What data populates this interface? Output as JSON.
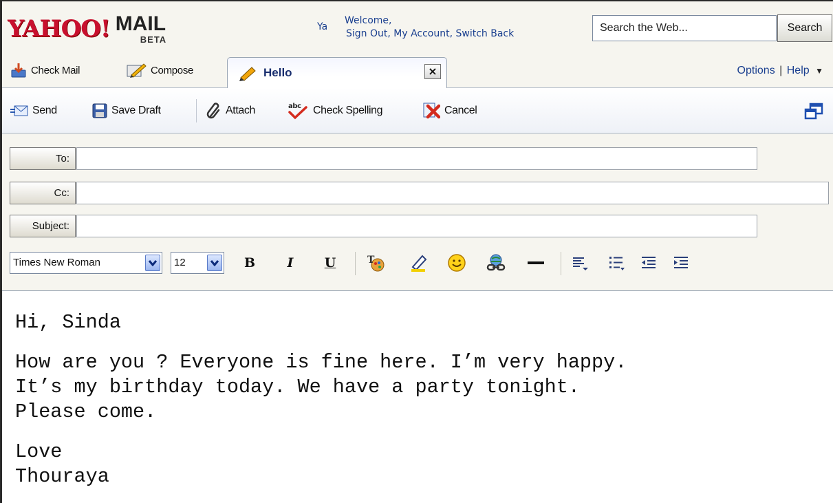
{
  "header": {
    "logo": {
      "yahoo": "YAHOO!",
      "mail": "MAIL",
      "beta": "BETA"
    },
    "welcome_prefix": "Ya",
    "welcome_text": "Welcome,",
    "account_links": "Sign Out, My Account, Switch Back",
    "search": {
      "value": "Search the Web...",
      "button_label": "Search"
    }
  },
  "tabs": {
    "check_mail_label": "Check Mail",
    "compose_label": "Compose",
    "active_tab_label": "Hello",
    "close_label": "×",
    "options_label": "Options",
    "help_label": "Help",
    "separator": "|"
  },
  "toolbar": {
    "send_label": "Send",
    "save_draft_label": "Save Draft",
    "attach_label": "Attach",
    "check_spelling_label": "Check Spelling",
    "cancel_label": "Cancel"
  },
  "fields": {
    "to_label": "To:",
    "cc_label": "Cc:",
    "subject_label": "Subject:",
    "to_value": "",
    "cc_value": "",
    "subject_value": ""
  },
  "format": {
    "font_family": "Times New Roman",
    "font_size": "12",
    "bold_label": "B",
    "italic_label": "I",
    "underline_label": "U"
  },
  "message": {
    "greeting": "Hi, Sinda",
    "line1": "How are you ? Everyone is fine here. I’m very happy.",
    "line2": "It’s my birthday today. We have a party tonight.",
    "line3": "Please come.",
    "closing": "Love",
    "signature": "Thouraya"
  },
  "colors": {
    "brand_red": "#c8102e",
    "link_blue": "#1a3f8f",
    "panel_bg": "#f6f5ef"
  }
}
